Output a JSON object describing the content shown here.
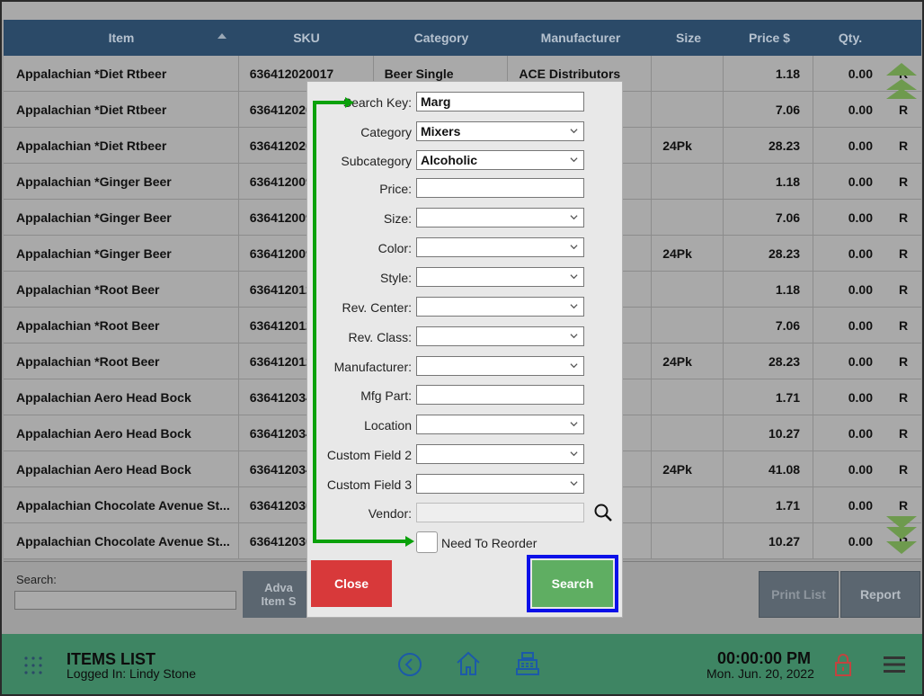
{
  "table": {
    "headers": {
      "item": "Item",
      "sku": "SKU",
      "category": "Category",
      "manufacturer": "Manufacturer",
      "size": "Size",
      "price": "Price $",
      "qty": "Qty."
    },
    "rows": [
      {
        "item": "Appalachian *Diet Rtbeer",
        "sku": "636412020017",
        "category": "Beer Single",
        "manufacturer": "ACE Distributors",
        "size": "",
        "price": "1.18",
        "qty": "0.00",
        "r": "R"
      },
      {
        "item": "Appalachian *Diet Rtbeer",
        "sku": "636412020",
        "category": "",
        "manufacturer": "",
        "size": "",
        "price": "7.06",
        "qty": "0.00",
        "r": "R"
      },
      {
        "item": "Appalachian *Diet Rtbeer",
        "sku": "636412020",
        "category": "",
        "manufacturer": "",
        "size": "24Pk",
        "price": "28.23",
        "qty": "0.00",
        "r": "R"
      },
      {
        "item": "Appalachian *Ginger Beer",
        "sku": "636412009",
        "category": "",
        "manufacturer": "",
        "size": "",
        "price": "1.18",
        "qty": "0.00",
        "r": "R"
      },
      {
        "item": "Appalachian *Ginger Beer",
        "sku": "636412009",
        "category": "",
        "manufacturer": "",
        "size": "",
        "price": "7.06",
        "qty": "0.00",
        "r": "R"
      },
      {
        "item": "Appalachian *Ginger Beer",
        "sku": "636412009",
        "category": "",
        "manufacturer": "",
        "size": "24Pk",
        "price": "28.23",
        "qty": "0.00",
        "r": "R"
      },
      {
        "item": "Appalachian *Root Beer",
        "sku": "636412012",
        "category": "",
        "manufacturer": "",
        "size": "",
        "price": "1.18",
        "qty": "0.00",
        "r": "R"
      },
      {
        "item": "Appalachian *Root Beer",
        "sku": "636412012",
        "category": "",
        "manufacturer": "",
        "size": "",
        "price": "7.06",
        "qty": "0.00",
        "r": "R"
      },
      {
        "item": "Appalachian *Root Beer",
        "sku": "636412012",
        "category": "",
        "manufacturer": "",
        "size": "24Pk",
        "price": "28.23",
        "qty": "0.00",
        "r": "R"
      },
      {
        "item": "Appalachian Aero Head Bock",
        "sku": "636412034",
        "category": "",
        "manufacturer": "",
        "size": "",
        "price": "1.71",
        "qty": "0.00",
        "r": "R"
      },
      {
        "item": "Appalachian Aero Head Bock",
        "sku": "636412034",
        "category": "",
        "manufacturer": "",
        "size": "",
        "price": "10.27",
        "qty": "0.00",
        "r": "R"
      },
      {
        "item": "Appalachian Aero Head Bock",
        "sku": "636412034",
        "category": "",
        "manufacturer": "",
        "size": "24Pk",
        "price": "41.08",
        "qty": "0.00",
        "r": "R"
      },
      {
        "item": "Appalachian Chocolate Avenue St...",
        "sku": "636412030",
        "category": "",
        "manufacturer": "",
        "size": "",
        "price": "1.71",
        "qty": "0.00",
        "r": "R"
      },
      {
        "item": "Appalachian Chocolate Avenue St...",
        "sku": "636412030",
        "category": "",
        "manufacturer": "",
        "size": "",
        "price": "10.27",
        "qty": "0.00",
        "r": "R"
      }
    ]
  },
  "toolbar": {
    "search_label": "Search:",
    "search_value": "",
    "advanced_line1": "Adva",
    "advanced_line2": "Item S",
    "print_list": "Print List",
    "report": "Report"
  },
  "status": {
    "title": "ITEMS LIST",
    "logged_in": "Logged In:   Lindy Stone",
    "time": "00:00:00 PM",
    "date": "Mon. Jun. 20, 2022"
  },
  "dialog": {
    "fields": [
      {
        "label": "Search Key:",
        "value": "Marg",
        "type": "text"
      },
      {
        "label": "Category",
        "value": "Mixers",
        "type": "select"
      },
      {
        "label": "Subcategory",
        "value": "Alcoholic",
        "type": "select"
      },
      {
        "label": "Price:",
        "value": "",
        "type": "text"
      },
      {
        "label": "Size:",
        "value": "",
        "type": "select"
      },
      {
        "label": "Color:",
        "value": "",
        "type": "select"
      },
      {
        "label": "Style:",
        "value": "",
        "type": "select"
      },
      {
        "label": "Rev. Center:",
        "value": "",
        "type": "select"
      },
      {
        "label": "Rev. Class:",
        "value": "",
        "type": "select"
      },
      {
        "label": "Manufacturer:",
        "value": "",
        "type": "select"
      },
      {
        "label": "Mfg Part:",
        "value": "",
        "type": "text"
      },
      {
        "label": "Location",
        "value": "",
        "type": "select"
      },
      {
        "label": "Custom Field 2",
        "value": "",
        "type": "select"
      },
      {
        "label": "Custom Field 3",
        "value": "",
        "type": "select"
      },
      {
        "label": "Vendor:",
        "value": "",
        "type": "disabled"
      }
    ],
    "reorder_label": "Need To Reorder",
    "close": "Close",
    "search": "Search"
  },
  "icons": {
    "grid": "grid-icon",
    "back": "back-arrow-icon",
    "home": "home-icon",
    "register": "cash-register-icon",
    "lock": "lock-icon",
    "menu": "hamburger-menu-icon",
    "vendor_search": "magnifier-icon",
    "scroll_up": "double-chevron-up-icon",
    "scroll_down": "double-chevron-down-icon"
  },
  "colors": {
    "header": "#2b4a68",
    "status_bar": "#3e8563",
    "close": "#d8393a",
    "search": "#5fae62",
    "highlight": "#0b10e8",
    "annotation": "#0aa10a",
    "scroll_arrows": "#6e9a4e"
  }
}
